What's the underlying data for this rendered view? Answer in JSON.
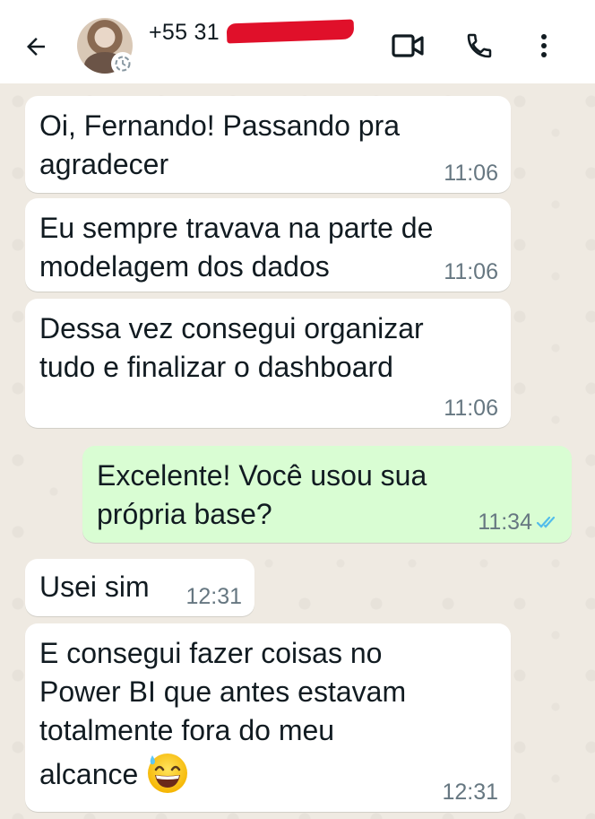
{
  "header": {
    "contact_name": "+55 31",
    "icons": [
      "back-arrow-icon",
      "video-call-icon",
      "phone-icon",
      "more-vert-icon"
    ]
  },
  "messages": [
    {
      "direction": "in",
      "lines": "Oi, Fernando! Passando pra\nagradecer",
      "time": "11:06"
    },
    {
      "direction": "in",
      "lines": "Eu sempre travava na parte de\nmodelagem dos dados",
      "time": "11:06"
    },
    {
      "direction": "in",
      "lines": "Dessa vez consegui organizar\ntudo e finalizar o dashboard",
      "time": "11:06"
    },
    {
      "direction": "out",
      "lines": "Excelente! Você usou sua\nprópria base?",
      "time": "11:34",
      "status": "read"
    },
    {
      "direction": "in",
      "lines": "Usei sim",
      "time": "12:31"
    },
    {
      "direction": "in",
      "lines": "E consegui fazer coisas no\nPower BI que antes estavam\ntotalmente fora do meu\nalcance",
      "time": "12:31",
      "emoji": "grinning-sweat-emoji"
    }
  ],
  "colors": {
    "incoming_bubble": "#ffffff",
    "outgoing_bubble": "#d9fdd3",
    "chat_background": "#efeae2",
    "read_ticks": "#53bdeb",
    "timestamp": "#667781"
  }
}
